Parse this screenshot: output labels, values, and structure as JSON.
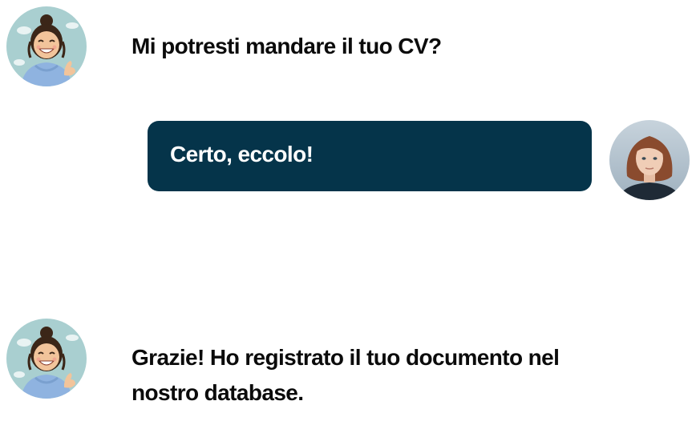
{
  "conversation": {
    "messages": [
      {
        "sender": "bot",
        "avatar": "cartoon-girl-avatar",
        "text": "Mi potresti mandare il tuo CV?"
      },
      {
        "sender": "user",
        "avatar": "user-photo-avatar",
        "text": "Certo, eccolo!"
      },
      {
        "sender": "bot",
        "avatar": "cartoon-girl-avatar",
        "text": "Grazie! Ho registrato il tuo documento nel nostro database."
      }
    ]
  },
  "colors": {
    "user_bubble_bg": "#05344a",
    "user_bubble_text": "#ffffff",
    "bot_text": "#0b0b0b",
    "background": "#ffffff"
  }
}
